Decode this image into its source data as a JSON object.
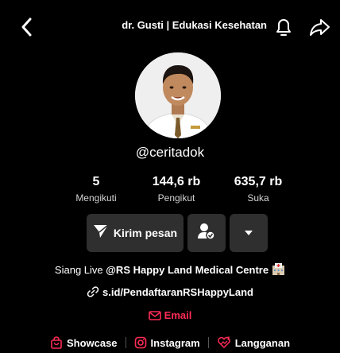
{
  "header": {
    "title": "dr. Gusti | Edukasi Kesehatan",
    "back_icon": "chevron-left-icon",
    "bell_icon": "bell-icon",
    "share_icon": "share-icon"
  },
  "profile": {
    "handle": "@ceritadok"
  },
  "stats": [
    {
      "value": "5",
      "label": "Mengikuti"
    },
    {
      "value": "144,6 rb",
      "label": "Pengikut"
    },
    {
      "value": "635,7 rb",
      "label": "Suka"
    }
  ],
  "actions": {
    "message_label": "Kirim pesan",
    "message_icon": "send-icon",
    "follow_icon": "user-check-icon",
    "more_icon": "caret-down-icon",
    "button_color": "#2f2f2f"
  },
  "bio": {
    "prefix": "Siang Live ",
    "mention": "@RS Happy Land Medical Centre",
    "emoji": "hospital-icon"
  },
  "link": {
    "text": "s.id/PendaftaranRSHappyLand",
    "icon": "link-icon"
  },
  "email": {
    "label": "Email",
    "icon": "mail-icon",
    "color": "#fe2c55"
  },
  "profile_links": [
    {
      "label": "Showcase",
      "icon": "shopping-bag-icon",
      "color": "#fe2c55"
    },
    {
      "label": "Instagram",
      "icon": "instagram-icon",
      "color": "#fe2c55"
    },
    {
      "label": "Langganan",
      "icon": "subscribe-icon",
      "color": "#fe2c55"
    }
  ]
}
